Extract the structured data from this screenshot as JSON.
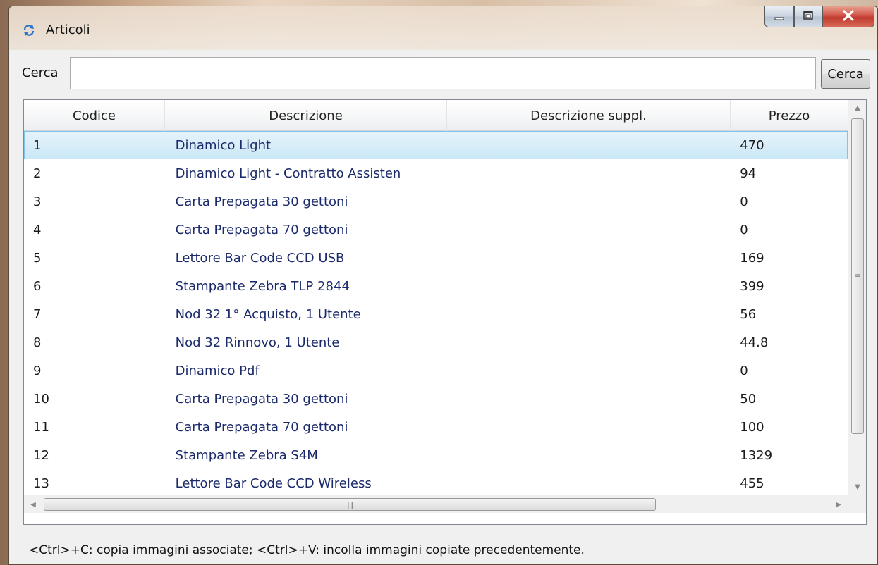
{
  "window": {
    "title": "Articoli"
  },
  "icons": {
    "app": "refresh-icon",
    "minimize": "minimize-icon",
    "maximize": "maximize-icon",
    "close": "close-icon"
  },
  "search": {
    "label": "Cerca",
    "value": "",
    "placeholder": "",
    "button_label": "Cerca"
  },
  "table": {
    "columns": [
      "Codice",
      "Descrizione",
      "Descrizione suppl.",
      "Prezzo"
    ],
    "selected_index": 0,
    "rows": [
      {
        "codice": "1",
        "descrizione": "Dinamico Light",
        "suppl": "",
        "prezzo": "470"
      },
      {
        "codice": "2",
        "descrizione": "Dinamico Light - Contratto Assisten",
        "suppl": "",
        "prezzo": "94"
      },
      {
        "codice": "3",
        "descrizione": "Carta Prepagata 30 gettoni",
        "suppl": "",
        "prezzo": "0"
      },
      {
        "codice": "4",
        "descrizione": "Carta Prepagata 70 gettoni",
        "suppl": "",
        "prezzo": "0"
      },
      {
        "codice": "5",
        "descrizione": "Lettore Bar Code CCD USB",
        "suppl": "",
        "prezzo": "169"
      },
      {
        "codice": "6",
        "descrizione": "Stampante Zebra TLP 2844",
        "suppl": "",
        "prezzo": "399"
      },
      {
        "codice": "7",
        "descrizione": "Nod 32 1° Acquisto, 1 Utente",
        "suppl": "",
        "prezzo": "56"
      },
      {
        "codice": "8",
        "descrizione": "Nod 32 Rinnovo, 1 Utente",
        "suppl": "",
        "prezzo": "44.8"
      },
      {
        "codice": "9",
        "descrizione": "Dinamico Pdf",
        "suppl": "",
        "prezzo": "0"
      },
      {
        "codice": "10",
        "descrizione": "Carta Prepagata 30 gettoni",
        "suppl": "",
        "prezzo": "50"
      },
      {
        "codice": "11",
        "descrizione": "Carta Prepagata 70 gettoni",
        "suppl": "",
        "prezzo": "100"
      },
      {
        "codice": "12",
        "descrizione": "Stampante Zebra S4M",
        "suppl": "",
        "prezzo": "1329"
      },
      {
        "codice": "13",
        "descrizione": "Lettore Bar Code CCD Wireless",
        "suppl": "",
        "prezzo": "455"
      }
    ]
  },
  "footer": {
    "hint": "<Ctrl>+C: copia immagini associate; <Ctrl>+V: incolla immagini copiate precedentemente."
  },
  "colors": {
    "selection": "#cbe8f6",
    "selection_border": "#7fc4ea",
    "close_button": "#c03a2e",
    "description_text": "#1b2a6b"
  }
}
